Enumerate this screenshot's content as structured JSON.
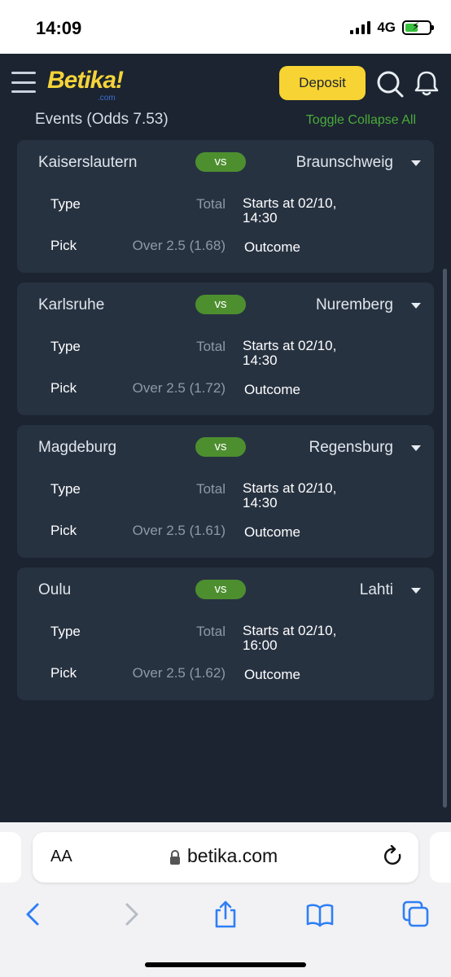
{
  "status": {
    "time": "14:09",
    "network": "4G"
  },
  "appbar": {
    "logo": "Betika!",
    "logo_sub": ".com",
    "deposit_label": "Deposit",
    "accent": "#f7d333"
  },
  "events": {
    "title": "Events (Odds 7.53)",
    "toggle_label": "Toggle Collapse All"
  },
  "labels": {
    "type": "Type",
    "pick": "Pick",
    "outcome": "Outcome",
    "vs": "vs"
  },
  "cards": [
    {
      "home": "Kaiserslautern",
      "away": "Braunschweig",
      "type_value": "Total",
      "starts": "Starts at 02/10, 14:30",
      "pick_value": "Over 2.5 (1.68)"
    },
    {
      "home": "Karlsruhe",
      "away": "Nuremberg",
      "type_value": "Total",
      "starts": "Starts at 02/10, 14:30",
      "pick_value": "Over 2.5 (1.72)"
    },
    {
      "home": "Magdeburg",
      "away": "Regensburg",
      "type_value": "Total",
      "starts": "Starts at 02/10, 14:30",
      "pick_value": "Over 2.5 (1.61)"
    },
    {
      "home": "Oulu",
      "away": "Lahti",
      "type_value": "Total",
      "starts": "Starts at 02/10, 16:00",
      "pick_value": "Over 2.5 (1.62)"
    }
  ],
  "browser": {
    "text_size": "AA",
    "url": "betika.com"
  },
  "icons": {
    "menu": "hamburger-menu-icon",
    "search": "search-icon",
    "bell": "bell-icon",
    "lock": "lock-icon",
    "reload": "reload-icon",
    "back": "back-icon",
    "forward": "forward-icon",
    "share": "share-icon",
    "bookmarks": "bookmarks-icon",
    "tabs": "tabs-icon"
  }
}
